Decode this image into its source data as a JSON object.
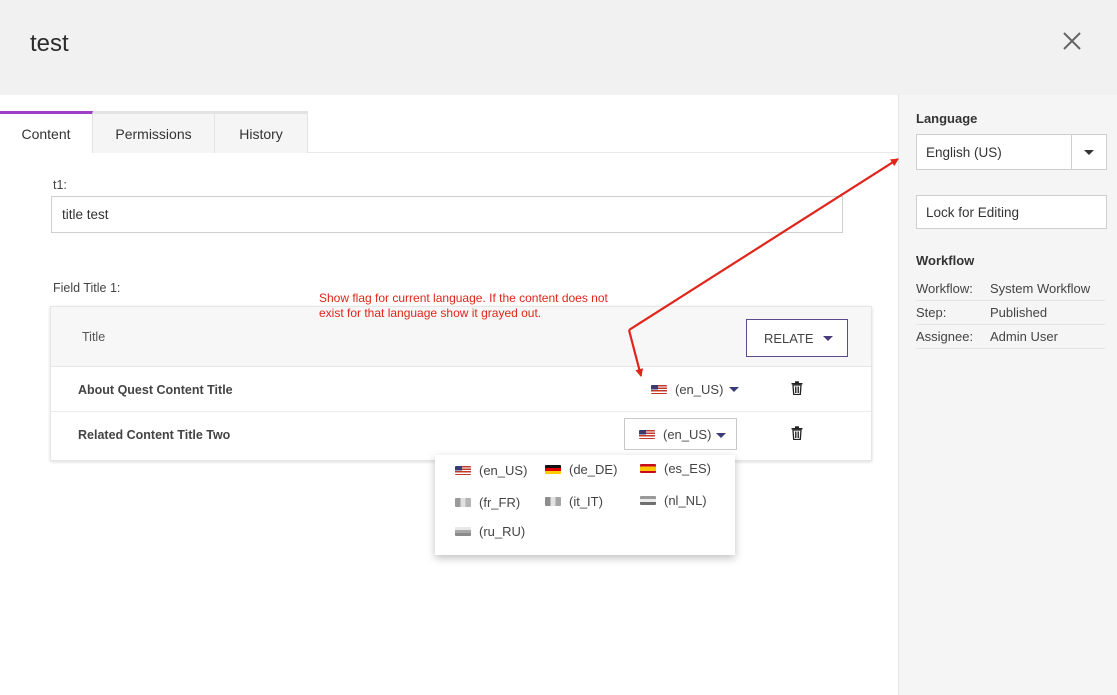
{
  "header": {
    "title": "test"
  },
  "tabs": [
    {
      "label": "Content",
      "active": true
    },
    {
      "label": "Permissions",
      "active": false
    },
    {
      "label": "History",
      "active": false
    }
  ],
  "fields": {
    "t1": {
      "label": "t1:",
      "value": "title test"
    },
    "field_title_1": {
      "label": "Field Title 1:"
    }
  },
  "grid": {
    "column_title": "Title",
    "relate_label": "RELATE",
    "rows": [
      {
        "title": "About Quest Content Title",
        "lang": "(en_US)"
      },
      {
        "title": "Related Content Title Two",
        "lang": "(en_US)"
      }
    ]
  },
  "language_menu": [
    {
      "code": "(en_US)",
      "flag": "flag-us"
    },
    {
      "code": "(de_DE)",
      "flag": "flag-de"
    },
    {
      "code": "(es_ES)",
      "flag": "flag-es"
    },
    {
      "code": "(fr_FR)",
      "flag": "flag-fr"
    },
    {
      "code": "(it_IT)",
      "flag": "flag-it"
    },
    {
      "code": "(nl_NL)",
      "flag": "flag-nl"
    },
    {
      "code": "(ru_RU)",
      "flag": "flag-ru"
    }
  ],
  "annotation": "Show flag for current language. If the content does not exist for that language show it grayed out.",
  "sidebar": {
    "language_label": "Language",
    "language_value": "English (US)",
    "lock_label": "Lock for Editing",
    "workflow_label": "Workflow",
    "workflow": [
      {
        "key": "Workflow:",
        "value": "System Workflow"
      },
      {
        "key": "Step:",
        "value": "Published"
      },
      {
        "key": "Assignee:",
        "value": "Admin User"
      }
    ]
  },
  "colors": {
    "accent": "#9b3ec8",
    "annotation": "#e0251b",
    "relate_border": "#5b4b8a"
  }
}
